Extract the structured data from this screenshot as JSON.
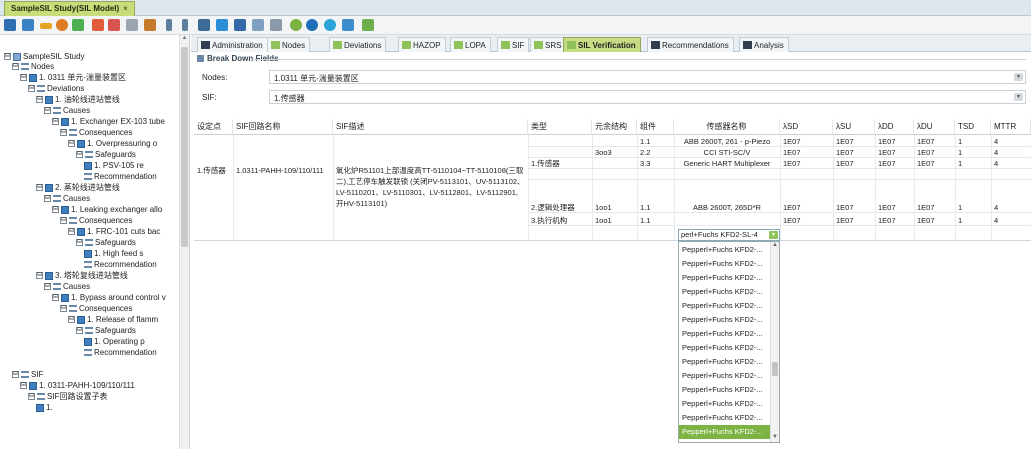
{
  "doc_tab": {
    "title": "SampleSIL Study(SIL Model)",
    "close": "×"
  },
  "tree": {
    "items": [
      {
        "label": "SampleSIL Study",
        "ex": "⊟",
        "icon": "study"
      },
      {
        "label": "Nodes",
        "ex": "⊟",
        "icon": "list"
      },
      {
        "label": "1. 0311 单元-湍量装置区",
        "ex": "⊟",
        "icon": "item"
      },
      {
        "label": "Deviations",
        "ex": "⊟",
        "icon": "list"
      },
      {
        "label": "1. 油轮线进站管线",
        "ex": "⊟",
        "icon": "item"
      },
      {
        "label": "Causes",
        "ex": "⊟",
        "icon": "list"
      },
      {
        "label": "1. Exchanger EX-103 tube",
        "ex": "⊟",
        "icon": "item"
      },
      {
        "label": "Consequences",
        "ex": "⊟",
        "icon": "list"
      },
      {
        "label": "1. Overpressuring o",
        "ex": "⊟",
        "icon": "item"
      },
      {
        "label": "Safeguards",
        "ex": "⊟",
        "icon": "list"
      },
      {
        "label": "1. PSV-105 re",
        "ex": "",
        "icon": "item"
      },
      {
        "label": "Recommendation",
        "ex": "",
        "icon": "list"
      },
      {
        "label": "2. 蒸轮线进站管线",
        "ex": "⊟",
        "icon": "item"
      },
      {
        "label": "Causes",
        "ex": "⊟",
        "icon": "list"
      },
      {
        "label": "1. Leaking exchanger allo",
        "ex": "⊟",
        "icon": "item"
      },
      {
        "label": "Consequences",
        "ex": "⊟",
        "icon": "list"
      },
      {
        "label": "1. FRC-101 cuts bac",
        "ex": "⊟",
        "icon": "item"
      },
      {
        "label": "Safeguards",
        "ex": "⊟",
        "icon": "list"
      },
      {
        "label": "1. High feed s",
        "ex": "",
        "icon": "item"
      },
      {
        "label": "Recommendation",
        "ex": "",
        "icon": "list"
      },
      {
        "label": "3. 塔轮复线进站管线",
        "ex": "⊟",
        "icon": "item"
      },
      {
        "label": "Causes",
        "ex": "⊟",
        "icon": "list"
      },
      {
        "label": "1. Bypass around control v",
        "ex": "⊟",
        "icon": "item"
      },
      {
        "label": "Consequences",
        "ex": "⊟",
        "icon": "list"
      },
      {
        "label": "1. Release of flamm",
        "ex": "⊟",
        "icon": "item"
      },
      {
        "label": "Safeguards",
        "ex": "⊟",
        "icon": "list"
      },
      {
        "label": "1. Operating p",
        "ex": "",
        "icon": "item"
      },
      {
        "label": "Recommendation",
        "ex": "",
        "icon": "list"
      },
      {
        "label": "SIF",
        "ex": "⊟",
        "icon": "list"
      },
      {
        "label": "1. 0311-PAHH-109/110/111",
        "ex": "⊟",
        "icon": "item"
      },
      {
        "label": "SIF回路设置子表",
        "ex": "⊟",
        "icon": "list"
      },
      {
        "label": "1.",
        "ex": "",
        "icon": "item"
      }
    ]
  },
  "tabs": [
    {
      "label": "Administration",
      "icon": "dark"
    },
    {
      "label": "Nodes",
      "icon": "green"
    },
    {
      "label": "Deviations",
      "icon": "green"
    },
    {
      "label": "HAZOP",
      "icon": "green"
    },
    {
      "label": "LOPA",
      "icon": "green"
    },
    {
      "label": "SIF",
      "icon": "green"
    },
    {
      "label": "SRS",
      "icon": "green"
    },
    {
      "label": "SIL Verification",
      "icon": "green",
      "active": true
    },
    {
      "label": "Recommendations",
      "icon": "dark"
    },
    {
      "label": "Analysis",
      "icon": "dark"
    }
  ],
  "breakdown": {
    "title": "Break Down Fields",
    "nodes_label": "Nodes:",
    "nodes_value": "1.0311 单元-湍量装置区",
    "sif_label": "SIF:",
    "sif_value": "1.传感器"
  },
  "grid": {
    "headers": [
      "设定点",
      "SIF回路名称",
      "SIF描述",
      "类型",
      "元余结构",
      "组件",
      "传感器名称",
      "λSD",
      "λSU",
      "λDD",
      "λDU",
      "TSD",
      "MTTR"
    ],
    "setpoint": "1.传感器",
    "sif_name": "1.0311-PAHH-109/110/111",
    "sif_desc": "氧化炉R51101上部温度高TT-5110104~TT-5110108(三取二),工艺停车触发联锁 (关闭PV-5113101、UV-5113102、LV-5110201、LV-5110301、LV-5112801、LV-5112901, 开HV-5113101)",
    "rows": [
      {
        "type": "",
        "redund": "",
        "comp": "1.1",
        "name": "ABB 2600T, 261 - p-Piezo",
        "lsd": "1E07",
        "lsu": "1E07",
        "ldd": "1E07",
        "ldu": "1E07",
        "tsd": "1",
        "mttr": "4"
      },
      {
        "type": "1.传感器",
        "redund": "3oo3",
        "comp": "2.2",
        "name": "CCI STI-SC/V",
        "lsd": "1E07",
        "lsu": "1E07",
        "ldd": "1E07",
        "ldu": "1E07",
        "tsd": "1",
        "mttr": "4"
      },
      {
        "type": "",
        "redund": "",
        "comp": "3.3",
        "name": "Generic HART Multiplexer",
        "lsd": "1E07",
        "lsu": "1E07",
        "ldd": "1E07",
        "ldu": "1E07",
        "tsd": "1",
        "mttr": "4"
      },
      {
        "type": "2.逻辑处理器",
        "redund": "1oo1",
        "comp": "1.1",
        "name": "ABB 2600T, 265D*R",
        "lsd": "1E07",
        "lsu": "1E07",
        "ldd": "1E07",
        "ldu": "1E07",
        "tsd": "1",
        "mttr": "4"
      },
      {
        "type": "3.执行机构",
        "redund": "1oo1",
        "comp": "1.1",
        "name": "",
        "lsd": "1E07",
        "lsu": "1E07",
        "ldd": "1E07",
        "ldu": "1E07",
        "tsd": "1",
        "mttr": "4"
      }
    ],
    "edit_value": "perl+Fuchs KFD2-SL-4"
  },
  "dropdown": {
    "options": [
      "Pepperl+Fuchs KFD2-...",
      "Pepperl+Fuchs KFD2-...",
      "Pepperl+Fuchs KFD2-...",
      "Pepperl+Fuchs KFD2-...",
      "Pepperl+Fuchs KFD2-...",
      "Pepperl+Fuchs KFD2-...",
      "Pepperl+Fuchs KFD2-...",
      "Pepperl+Fuchs KFD2-...",
      "Pepperl+Fuchs KFD2-...",
      "Pepperl+Fuchs KFD2-...",
      "Pepperl+Fuchs KFD2-...",
      "Pepperl+Fuchs KFD2-...",
      "Pepperl+Fuchs KFD2-...",
      "Pepperl+Fuchs KFD2-..."
    ],
    "selected_index": 13
  }
}
